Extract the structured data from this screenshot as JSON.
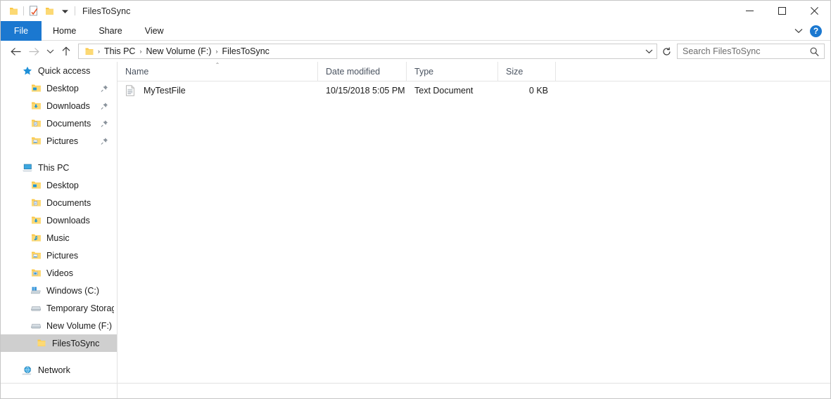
{
  "window": {
    "title": "FilesToSync",
    "quick_access_toolbar": [
      {
        "name": "folder-icon",
        "tooltip": "Properties"
      },
      {
        "name": "properties-checkmark-icon",
        "tooltip": "Properties"
      },
      {
        "name": "new-folder-icon",
        "tooltip": "New folder"
      },
      {
        "name": "chevron-down-icon",
        "tooltip": "Customize Quick Access Toolbar"
      }
    ],
    "controls": {
      "minimize": "—",
      "maximize": "□",
      "close": "✕"
    }
  },
  "ribbon": {
    "tabs": [
      {
        "label": "File",
        "active": true
      },
      {
        "label": "Home",
        "active": false
      },
      {
        "label": "Share",
        "active": false
      },
      {
        "label": "View",
        "active": false
      }
    ],
    "expand_icon": "chevron-down-icon",
    "help_label": "?"
  },
  "address_bar": {
    "back_icon": "←",
    "forward_icon": "→",
    "recent_icon": "⌄",
    "up_icon": "↑",
    "folder_icon": "folder-icon",
    "crumbs": [
      "This PC",
      "New Volume (F:)",
      "FilesToSync"
    ],
    "separator": "›",
    "dropdown_icon": "⌄",
    "refresh_icon": "↻"
  },
  "search": {
    "placeholder": "Search FilesToSync",
    "value": "",
    "icon": "search-icon"
  },
  "sidebar": {
    "groups": [
      {
        "header": {
          "label": "Quick access",
          "icon": "star-icon",
          "level": 0
        },
        "items": [
          {
            "label": "Desktop",
            "icon": "folder-desktop-icon",
            "level": 1,
            "pinned": true
          },
          {
            "label": "Downloads",
            "icon": "folder-downloads-icon",
            "level": 1,
            "pinned": true
          },
          {
            "label": "Documents",
            "icon": "folder-documents-icon",
            "level": 1,
            "pinned": true
          },
          {
            "label": "Pictures",
            "icon": "folder-pictures-icon",
            "level": 1,
            "pinned": true
          }
        ]
      },
      {
        "header": {
          "label": "This PC",
          "icon": "this-pc-icon",
          "level": 0
        },
        "items": [
          {
            "label": "Desktop",
            "icon": "folder-desktop-icon",
            "level": 1,
            "pinned": false
          },
          {
            "label": "Documents",
            "icon": "folder-documents-icon",
            "level": 1,
            "pinned": false
          },
          {
            "label": "Downloads",
            "icon": "folder-downloads-icon",
            "level": 1,
            "pinned": false
          },
          {
            "label": "Music",
            "icon": "folder-music-icon",
            "level": 1,
            "pinned": false
          },
          {
            "label": "Pictures",
            "icon": "folder-pictures-icon",
            "level": 1,
            "pinned": false
          },
          {
            "label": "Videos",
            "icon": "folder-videos-icon",
            "level": 1,
            "pinned": false
          },
          {
            "label": "Windows (C:)",
            "icon": "system-drive-icon",
            "level": 1,
            "pinned": false
          },
          {
            "label": "Temporary Storage (",
            "icon": "drive-icon",
            "level": 1,
            "pinned": false
          },
          {
            "label": "New Volume (F:)",
            "icon": "drive-icon",
            "level": 1,
            "pinned": false
          },
          {
            "label": "FilesToSync",
            "icon": "folder-icon",
            "level": 2,
            "pinned": false,
            "selected": true
          }
        ]
      },
      {
        "header": {
          "label": "Network",
          "icon": "network-icon",
          "level": 0
        },
        "items": []
      }
    ]
  },
  "file_list": {
    "columns": [
      {
        "label": "Name",
        "sorted": true,
        "sort_dir": "asc"
      },
      {
        "label": "Date modified",
        "sorted": false
      },
      {
        "label": "Type",
        "sorted": false
      },
      {
        "label": "Size",
        "sorted": false
      }
    ],
    "sort_caret": "⌃",
    "rows": [
      {
        "name": "MyTestFile",
        "date_modified": "10/15/2018 5:05 PM",
        "type": "Text Document",
        "size": "0 KB",
        "icon": "text-document-icon"
      }
    ]
  },
  "colors": {
    "accent": "#1b78d0",
    "folder": "#fbc847",
    "selection": "#cfcfcf",
    "header_text": "#4a5360"
  }
}
